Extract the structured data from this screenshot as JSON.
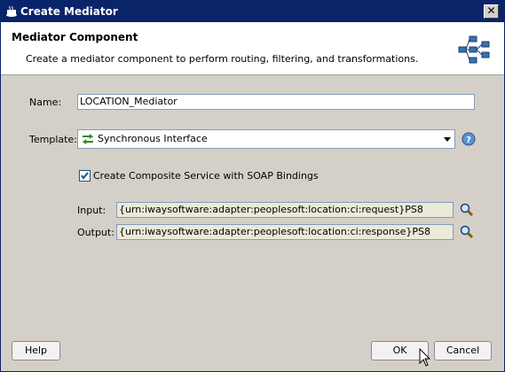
{
  "window": {
    "title": "Create Mediator",
    "close_glyph": "✕"
  },
  "header": {
    "title": "Mediator Component",
    "description": "Create a mediator component to perform routing, filtering, and transformations."
  },
  "form": {
    "name_label": "Name:",
    "name_value": "LOCATION_Mediator",
    "template_label": "Template:",
    "template_value": "Synchronous Interface",
    "composite_checkbox_label": "Create Composite Service with SOAP Bindings",
    "composite_checked": true,
    "input_label": "Input:",
    "input_value": "{urn:iwaysoftware:adapter:peoplesoft:location:ci:request}PS8",
    "output_label": "Output:",
    "output_value": "{urn:iwaysoftware:adapter:peoplesoft:location:ci:response}PS8"
  },
  "buttons": {
    "help": "Help",
    "ok": "OK",
    "cancel": "Cancel"
  },
  "icons": {
    "app": "coffee-cup-icon",
    "header": "mediator-network-icon",
    "template": "sync-arrows-icon",
    "help": "question-mark-icon",
    "search": "magnifier-icon"
  }
}
